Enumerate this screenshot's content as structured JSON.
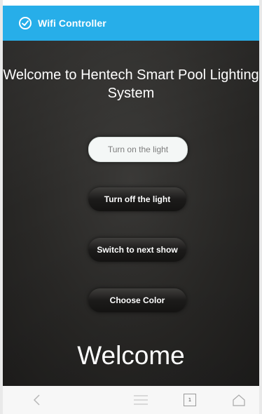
{
  "app": {
    "title": "Wifi Controller",
    "icon": "refresh-icon",
    "accent_color": "#27aee9"
  },
  "main": {
    "heading": "Welcome to Hentech Smart Pool Lighting System",
    "buttons": {
      "turn_on": "Turn on the light",
      "turn_off": "Turn off the light",
      "next_show": "Switch to next show",
      "choose_color": "Choose Color"
    },
    "footer_text": "Welcome"
  },
  "navbar": {
    "back_icon": "back-icon",
    "menu_icon": "menu-icon",
    "tabs_icon": "tabs-icon",
    "tabs_count": "1",
    "home_icon": "home-icon"
  }
}
